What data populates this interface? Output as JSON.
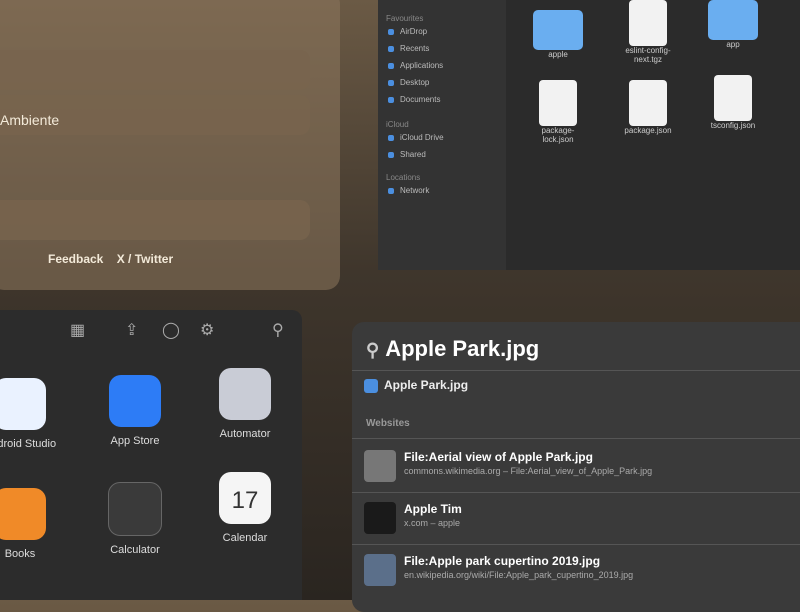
{
  "background_window": {
    "address_text": "Ambiente",
    "footer_links": [
      "Feedback",
      "X / Twitter"
    ]
  },
  "finder": {
    "sidebar_sections": [
      {
        "heading": "Favourites",
        "items": [
          "AirDrop",
          "Recents",
          "Applications",
          "Desktop",
          "Documents"
        ]
      },
      {
        "heading": "iCloud",
        "items": [
          "iCloud Drive",
          "Shared"
        ]
      },
      {
        "heading": "Locations",
        "items": [
          "Network"
        ]
      }
    ],
    "files": [
      {
        "name": "apple",
        "kind": "folder"
      },
      {
        "name": "eslint-config-next.tgz",
        "kind": "doc"
      },
      {
        "name": "app",
        "kind": "folder"
      },
      {
        "name": "package-lock.json",
        "kind": "doc"
      },
      {
        "name": "package.json",
        "kind": "doc"
      },
      {
        "name": "tsconfig.json",
        "kind": "doc"
      }
    ]
  },
  "launchpad": {
    "apps": [
      {
        "label": "Android Studio",
        "color": "#eaf2ff"
      },
      {
        "label": "App Store",
        "color": "#2d7cf6"
      },
      {
        "label": "Automator",
        "color": "#c9ccd6"
      },
      {
        "label": "Books",
        "color": "#f08a28"
      },
      {
        "label": "Calculator",
        "color": "#3a3a3a"
      },
      {
        "label": "Calendar",
        "color": "#f5f5f5"
      }
    ],
    "calendar_day": "17"
  },
  "spotlight": {
    "query": "Apple Park.jpg",
    "top_hit": "Apple Park.jpg",
    "section_label": "Websites",
    "results": [
      {
        "title": "File:Aerial view of Apple Park.jpg",
        "subtitle": "commons.wikimedia.org – File:Aerial_view_of_Apple_Park.jpg"
      },
      {
        "title": "Apple Tim",
        "subtitle": "x.com – apple"
      },
      {
        "title": "File:Apple park cupertino 2019.jpg",
        "subtitle": "en.wikipedia.org/wiki/File:Apple_park_cupertino_2019.jpg"
      }
    ]
  }
}
